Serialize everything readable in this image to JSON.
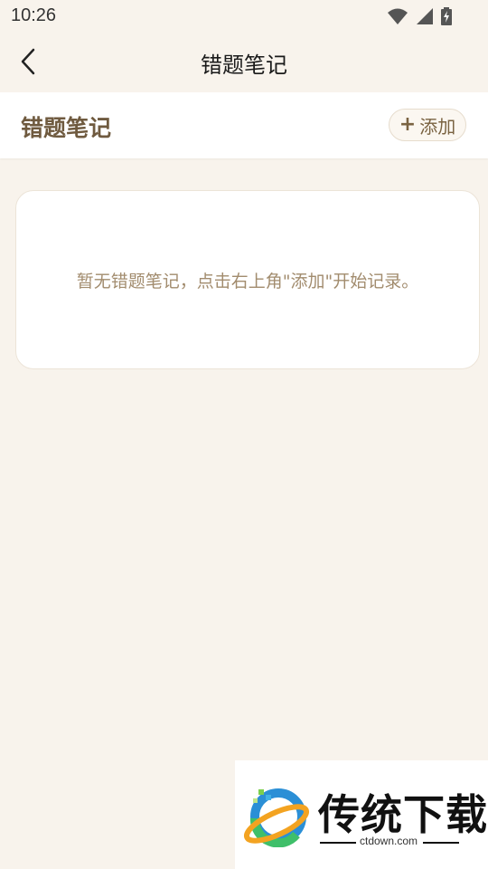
{
  "status_bar": {
    "time": "10:26"
  },
  "app_bar": {
    "title": "错题笔记"
  },
  "section": {
    "title": "错题笔记",
    "add_label": "添加",
    "add_icon": "+"
  },
  "empty_state": {
    "message": "暂无错题笔记，点击右上角\"添加\"开始记录。"
  },
  "watermark": {
    "brand": "传统下载",
    "site": "ctdown.com"
  },
  "colors": {
    "background": "#f8f3ec",
    "section_title": "#6f5a3f",
    "accent_text": "#a28c6e",
    "card": "#ffffff"
  }
}
